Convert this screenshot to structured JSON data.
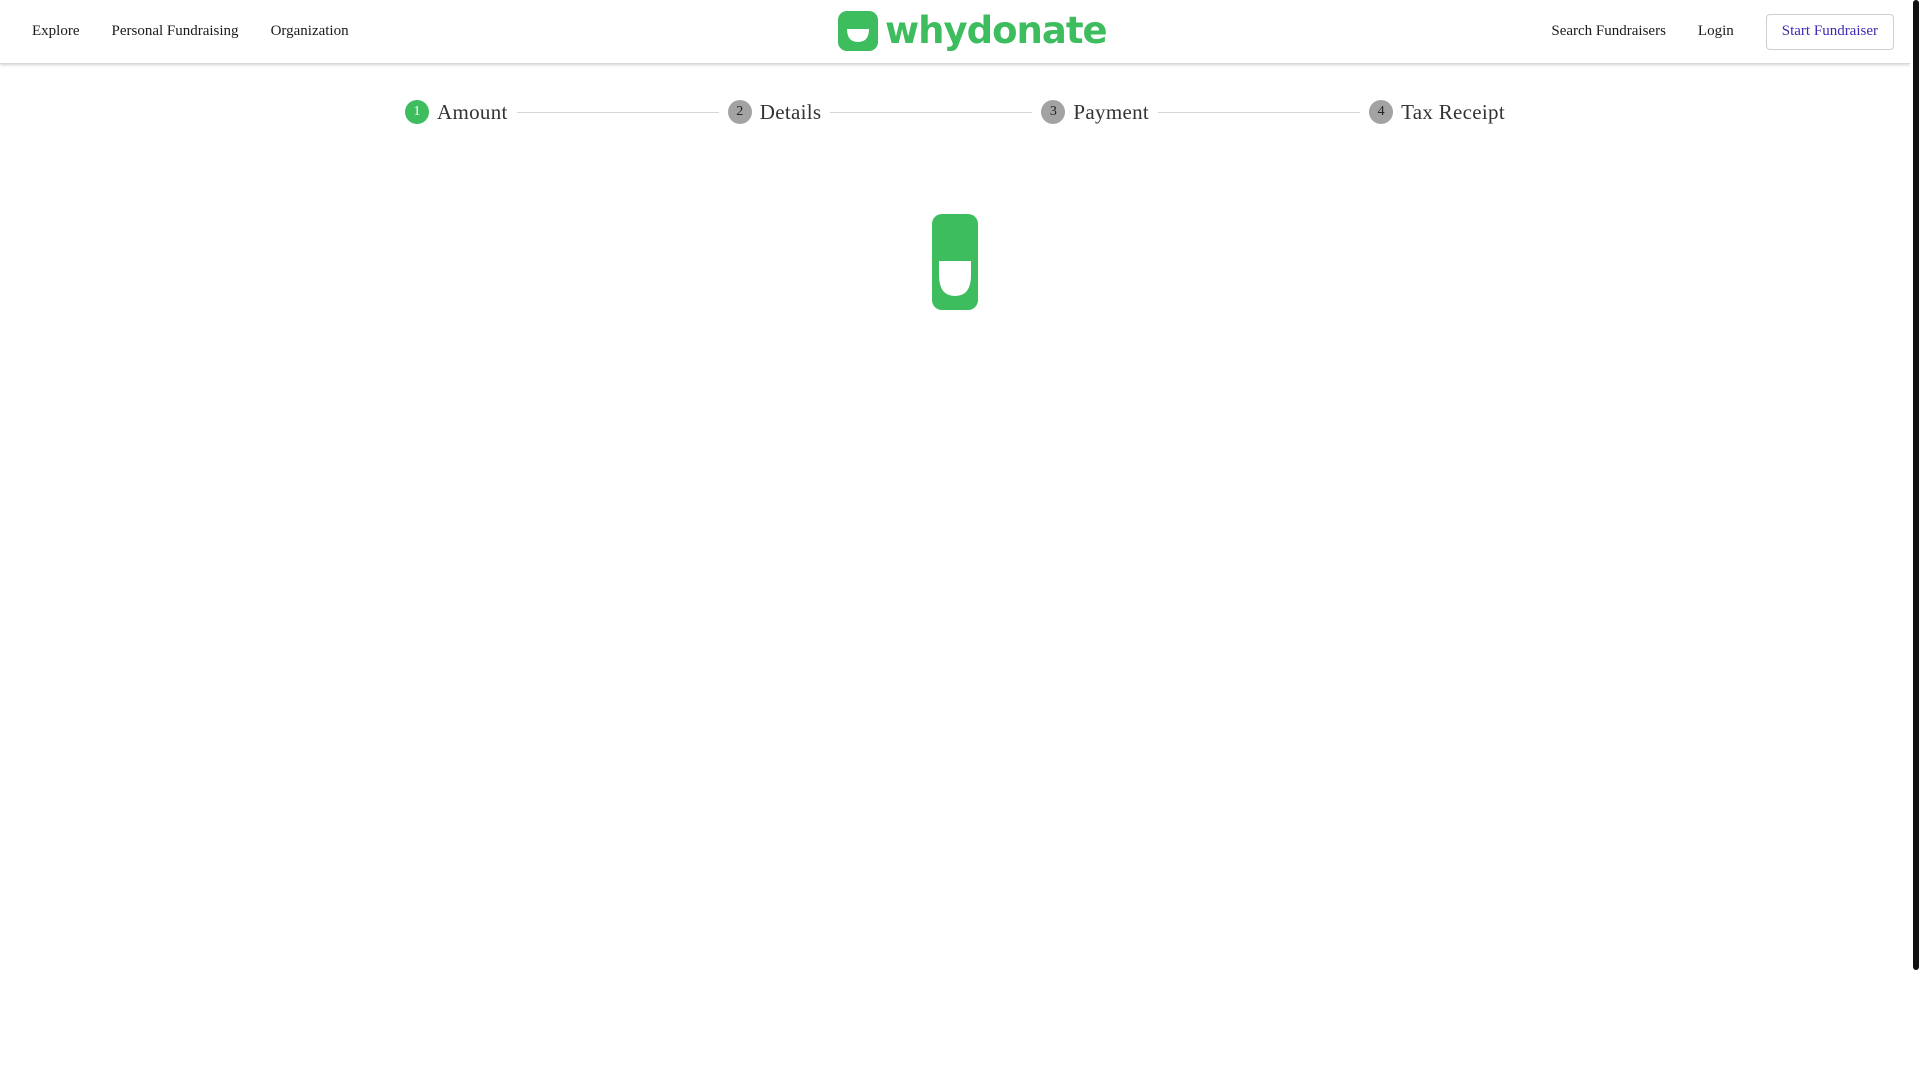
{
  "header": {
    "nav_left": [
      "Explore",
      "Personal Fundraising",
      "Organization"
    ],
    "logo_text": "whydonate",
    "search_label": "Search Fundraisers",
    "login_label": "Login",
    "start_label": "Start Fundraiser"
  },
  "stepper": {
    "steps": [
      {
        "number": "1",
        "label": "Amount",
        "active": true
      },
      {
        "number": "2",
        "label": "Details",
        "active": false
      },
      {
        "number": "3",
        "label": "Payment",
        "active": false
      },
      {
        "number": "4",
        "label": "Tax Receipt",
        "active": false
      }
    ]
  },
  "colors": {
    "brand": "#3dbd5d",
    "inactive_step": "#a3a3a3",
    "start_button_text": "#3b2bb0"
  },
  "icons": {
    "logo": "whydonate-smile-icon",
    "loader": "whydonate-loading-icon"
  }
}
